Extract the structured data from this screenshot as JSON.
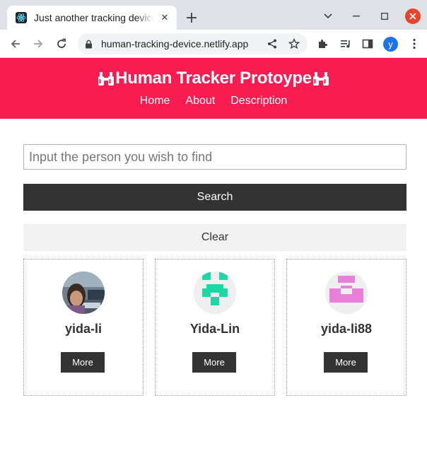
{
  "browser": {
    "tab_title": "Just another tracking device",
    "url": "human-tracking-device.netlify.app",
    "profile_initial": "y"
  },
  "site": {
    "title": "Human Tracker Protoype",
    "brand_color": "#f81c50",
    "nav": [
      "Home",
      "About",
      "Description"
    ]
  },
  "search": {
    "placeholder": "Input the person you wish to find",
    "value": "",
    "search_label": "Search",
    "clear_label": "Clear"
  },
  "results": [
    {
      "name": "yida-li",
      "avatar": "photo",
      "more_label": "More"
    },
    {
      "name": "Yida-Lin",
      "avatar": "identicon-teal",
      "more_label": "More",
      "avatar_color": "#1fd6a7"
    },
    {
      "name": "yida-li88",
      "avatar": "identicon-pink",
      "more_label": "More",
      "avatar_color": "#e87fd9"
    }
  ]
}
